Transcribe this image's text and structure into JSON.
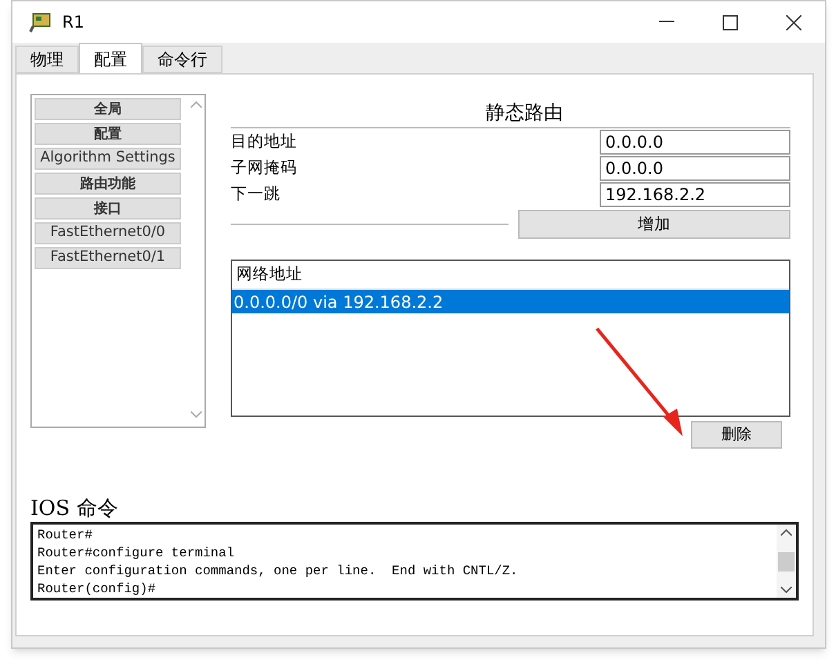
{
  "window": {
    "title": "R1"
  },
  "tabs": [
    {
      "label": "物理",
      "selected": false
    },
    {
      "label": "配置",
      "selected": true
    },
    {
      "label": "命令行",
      "selected": false
    }
  ],
  "sidebar": {
    "items": [
      {
        "label": "全局",
        "kind": "header"
      },
      {
        "label": "配置",
        "kind": "header"
      },
      {
        "label": "Algorithm Settings",
        "kind": "item"
      },
      {
        "label": "路由功能",
        "kind": "header"
      },
      {
        "label": "接口",
        "kind": "header"
      },
      {
        "label": "FastEthernet0/0",
        "kind": "item"
      },
      {
        "label": "FastEthernet0/1",
        "kind": "item"
      }
    ]
  },
  "static_route": {
    "title": "静态路由",
    "fields": [
      {
        "label": "目的地址",
        "value": "0.0.0.0"
      },
      {
        "label": "子网掩码",
        "value": "0.0.0.0"
      },
      {
        "label": "下一跳",
        "value": "192.168.2.2"
      }
    ],
    "add_button": "增加",
    "list": {
      "header": "网络地址",
      "rows": [
        {
          "text": "0.0.0.0/0 via 192.168.2.2",
          "selected": true
        }
      ]
    },
    "delete_button": "删除"
  },
  "ios": {
    "title": "IOS 命令",
    "lines": [
      "Router#",
      "Router#configure terminal",
      "Enter configuration commands, one per line.  End with CNTL/Z.",
      "Router(config)#"
    ]
  }
}
